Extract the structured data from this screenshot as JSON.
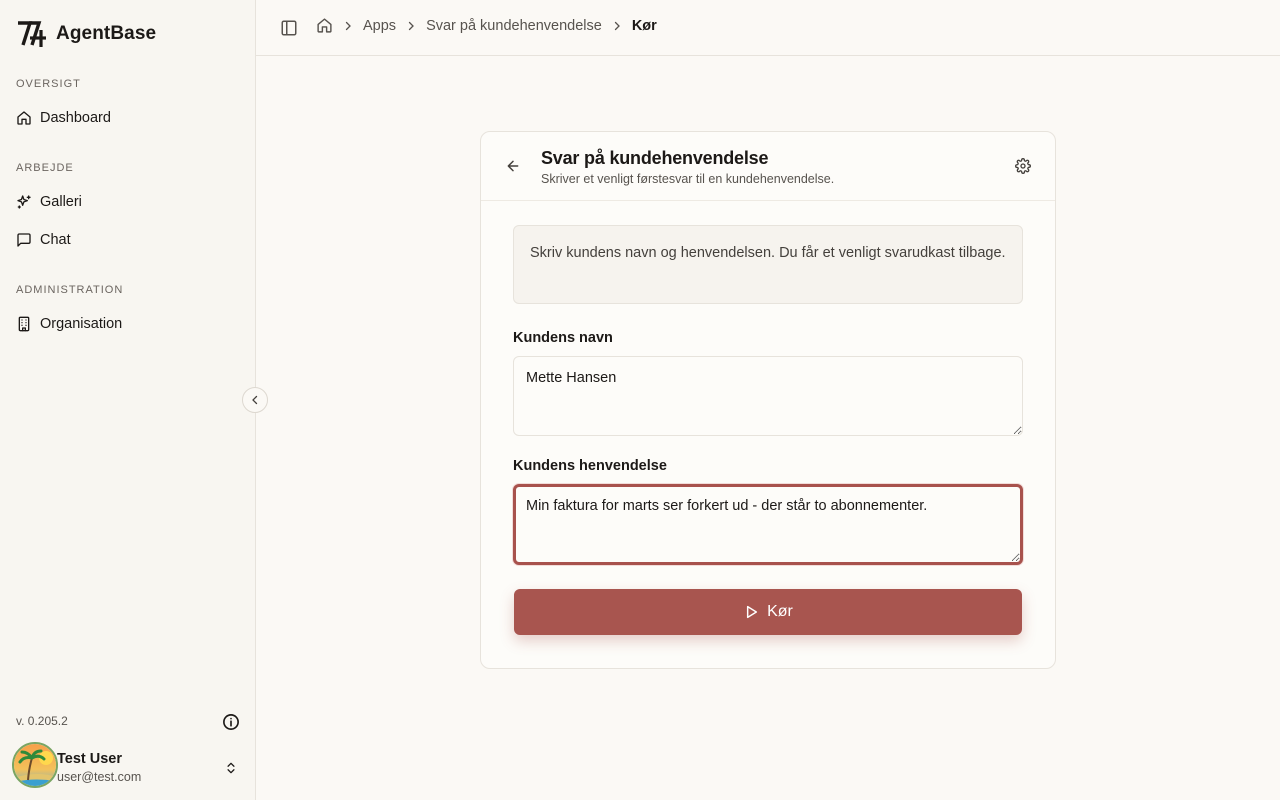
{
  "app": {
    "name": "AgentBase",
    "version": "v. 0.205.2"
  },
  "sidebar": {
    "sections": [
      {
        "label": "OVERSIGT",
        "items": [
          {
            "label": "Dashboard",
            "icon": "home-icon"
          }
        ]
      },
      {
        "label": "ARBEJDE",
        "items": [
          {
            "label": "Galleri",
            "icon": "sparkles-icon"
          },
          {
            "label": "Chat",
            "icon": "message-square-icon"
          }
        ]
      },
      {
        "label": "ADMINISTRATION",
        "items": [
          {
            "label": "Organisation",
            "icon": "building-icon"
          }
        ]
      }
    ]
  },
  "user": {
    "name": "Test User",
    "email": "user@test.com"
  },
  "breadcrumb": {
    "items": [
      "Apps",
      "Svar på kundehenvendelse"
    ],
    "current": "Kør"
  },
  "card": {
    "title": "Svar på kundehenvendelse",
    "subtitle": "Skriver et venligt førstesvar til en kundehenvendelse.",
    "notice": "Skriv kundens navn og henvendelsen. Du får et venligt svarudkast tilbage.",
    "fields": [
      {
        "label": "Kundens navn",
        "value": "Mette Hansen"
      },
      {
        "label": "Kundens henvendelse",
        "value": "Min faktura for marts ser forkert ud - der står to abonnementer."
      }
    ],
    "run_label": "Kør"
  },
  "colors": {
    "accent": "#a8554f",
    "background": "#fbf9f5",
    "sidebar": "#f8f6f1"
  }
}
